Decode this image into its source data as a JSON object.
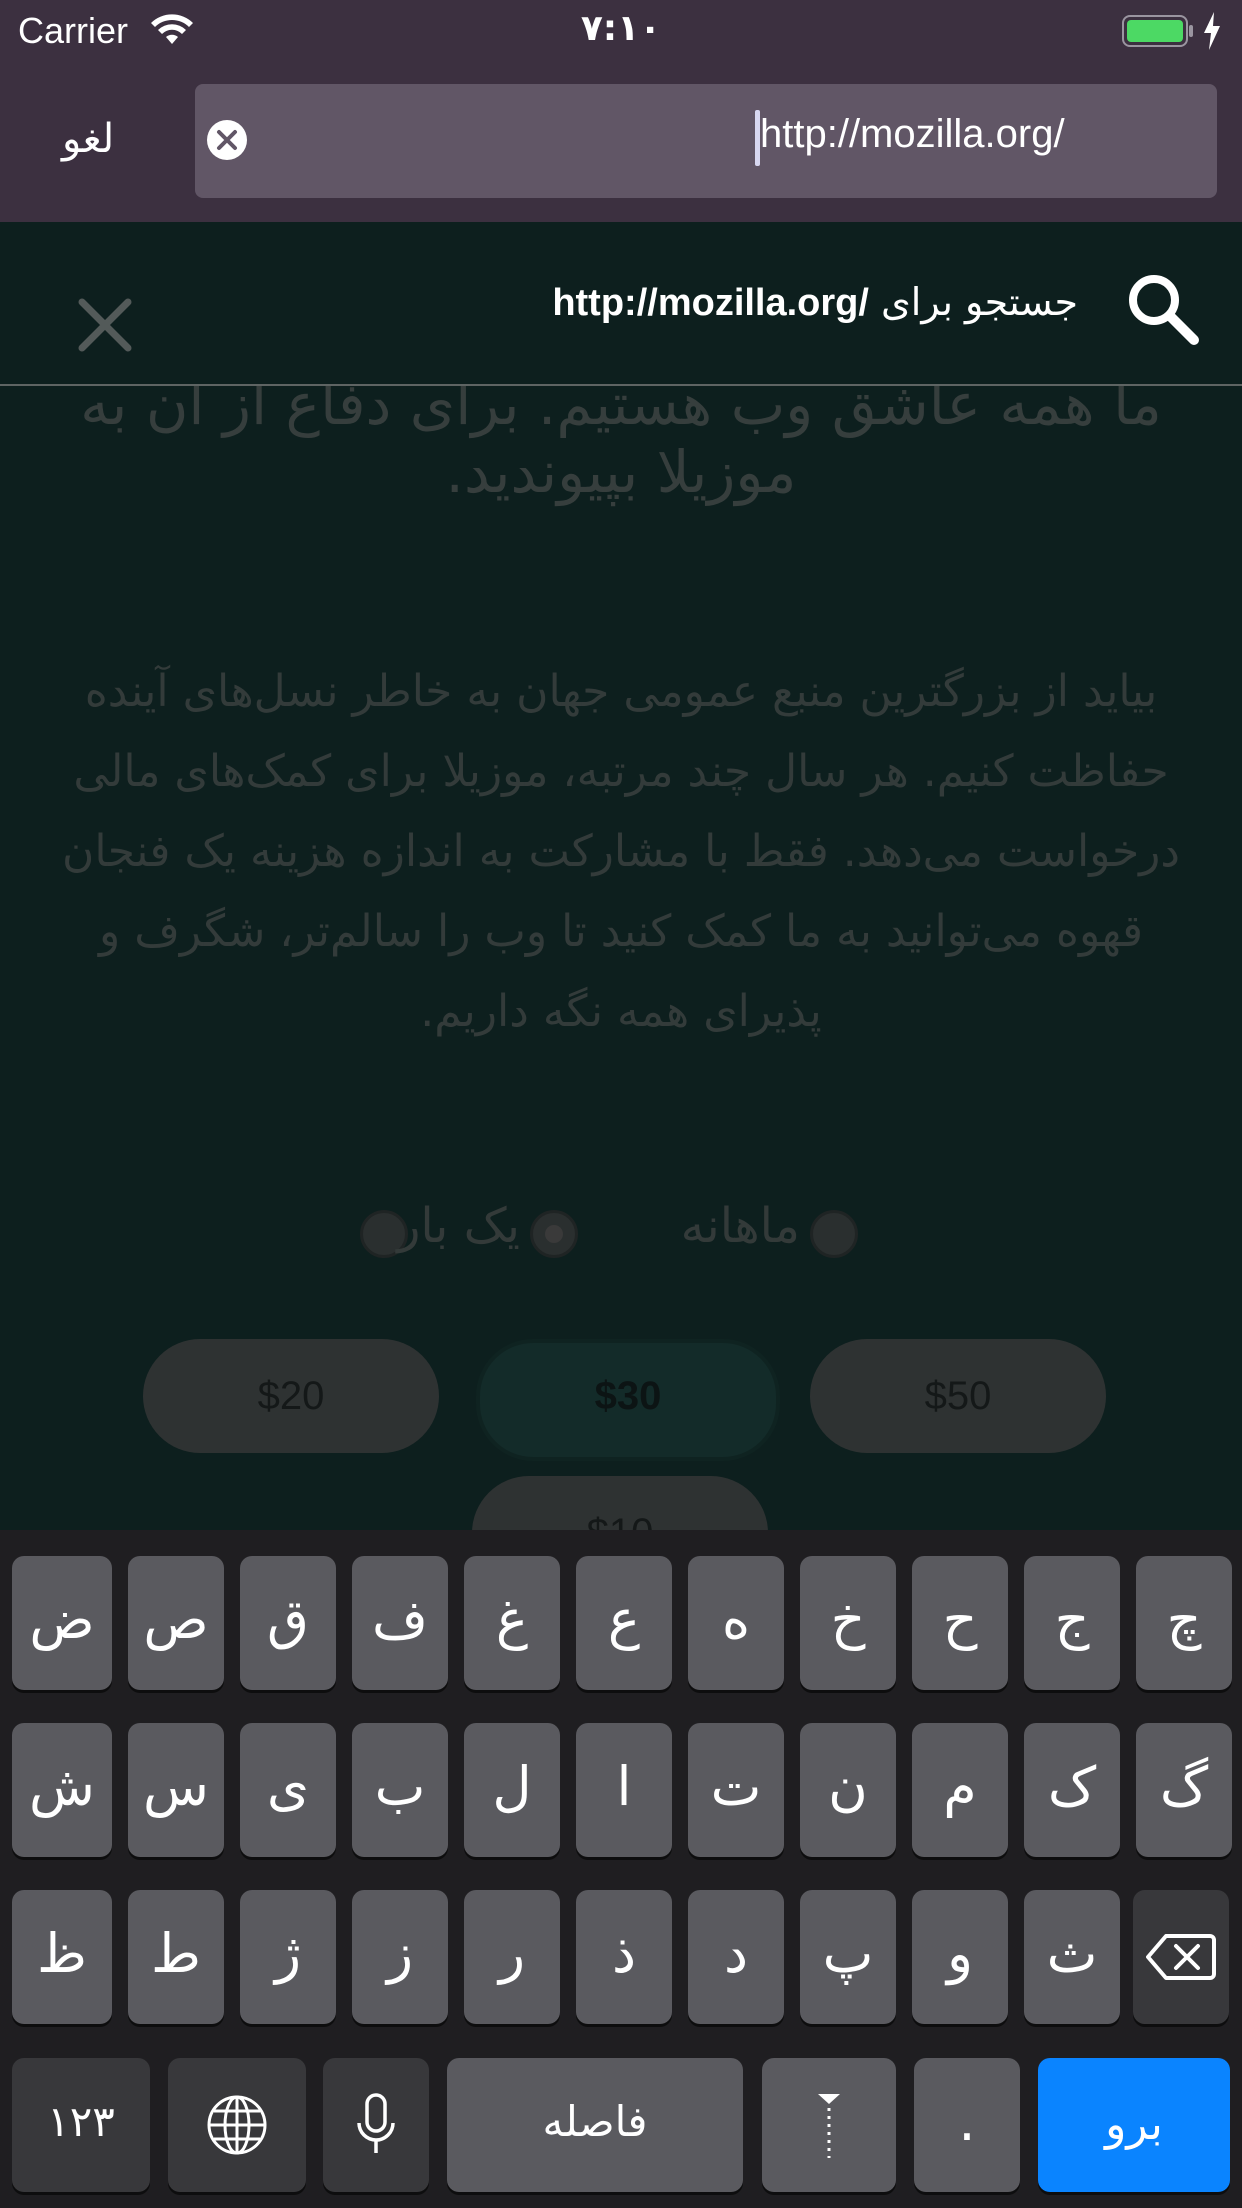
{
  "status_bar": {
    "carrier": "Carrier",
    "time": "۷:۱۰"
  },
  "url_bar": {
    "cancel_label": "لغو",
    "url_value": "http://mozilla.org/"
  },
  "suggestion": {
    "prefix": "جستجو برای",
    "query": "http://mozilla.org/"
  },
  "page": {
    "title": "ما همه عاشق وب هستیم. برای دفاع از آن به موزیلا بپیوندید.",
    "body": "بیاید از بزرگترین منبع عمومی جهان به خاطر نسل‌های آینده حفاظت کنیم. هر سال چند مرتبه، موزیلا برای کمک‌های مالی درخواست می‌دهد. فقط با مشارکت به اندازه هزینه یک فنجان قهوه می‌توانید به ما کمک کنید تا وب را سالم‌تر، شگرف و پذیرای همه نگه داریم.",
    "frequency_monthly": "ماهانه",
    "frequency_once": "یک بار",
    "amounts": [
      "$20",
      "$30",
      "$50",
      "$10"
    ]
  },
  "keyboard": {
    "row1": [
      "ض",
      "ص",
      "ق",
      "ف",
      "غ",
      "ع",
      "ه",
      "خ",
      "ح",
      "ج",
      "چ"
    ],
    "row2": [
      "ش",
      "س",
      "ی",
      "ب",
      "ل",
      "ا",
      "ت",
      "ن",
      "م",
      "ک",
      "گ"
    ],
    "row3": [
      "ظ",
      "ط",
      "ژ",
      "ز",
      "ر",
      "ذ",
      "د",
      "پ",
      "و",
      "ث"
    ],
    "numbers_label": "۱۲۳",
    "space_label": "فاصله",
    "period_label": ".",
    "go_label": "برو"
  },
  "colors": {
    "chrome": "#3c3040",
    "url_field": "#615666",
    "page_bg": "#0d1f1e",
    "go_key": "#0a84ff",
    "keyboard_bg": "#1f1e21"
  }
}
